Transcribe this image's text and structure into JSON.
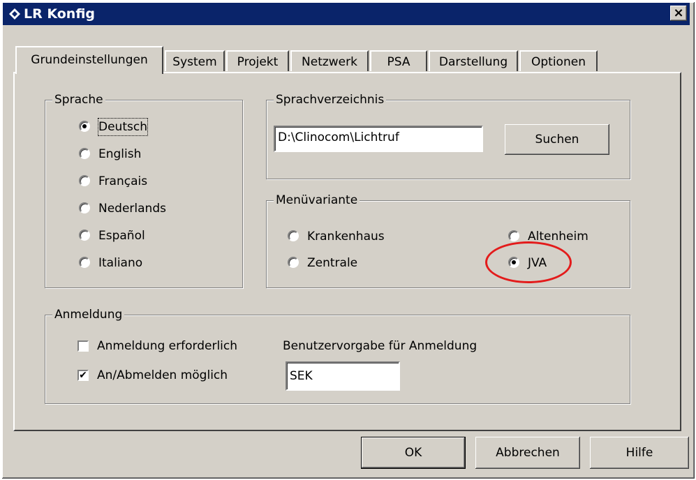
{
  "window": {
    "title": "LR Konfig",
    "close_glyph": "×"
  },
  "tabs": [
    {
      "label": "Grundeinstellungen",
      "active": true
    },
    {
      "label": "System"
    },
    {
      "label": "Projekt"
    },
    {
      "label": "Netzwerk"
    },
    {
      "label": "PSA"
    },
    {
      "label": "Darstellung"
    },
    {
      "label": "Optionen"
    }
  ],
  "sprache": {
    "legend": "Sprache",
    "options": [
      {
        "label": "Deutsch",
        "checked": true
      },
      {
        "label": "English"
      },
      {
        "label": "Français"
      },
      {
        "label": "Nederlands"
      },
      {
        "label": "Español"
      },
      {
        "label": "Italiano"
      }
    ]
  },
  "sprachverzeichnis": {
    "legend": "Sprachverzeichnis",
    "path_value": "D:\\Clinocom\\Lichtruf",
    "search_label": "Suchen"
  },
  "menuvariante": {
    "legend": "Menüvariante",
    "options": [
      {
        "label": "Krankenhaus"
      },
      {
        "label": "Zentrale"
      },
      {
        "label": "Altenheim"
      },
      {
        "label": "JVA",
        "checked": true
      }
    ]
  },
  "anmeldung": {
    "legend": "Anmeldung",
    "required_label": "Anmeldung erforderlich",
    "required_checked": false,
    "login_possible_label": "An/Abmelden möglich",
    "login_possible_checked": true,
    "default_user_label": "Benutzervorgabe für Anmeldung",
    "default_user_value": "SEK"
  },
  "buttons": {
    "ok": "OK",
    "cancel": "Abbrechen",
    "help": "Hilfe"
  },
  "colors": {
    "titlebar": "#0a246a",
    "dialog_face": "#d4d0c8",
    "annotation": "#e31b1b"
  },
  "icons": {
    "title": "diamond-app-icon",
    "close": "close-icon"
  }
}
